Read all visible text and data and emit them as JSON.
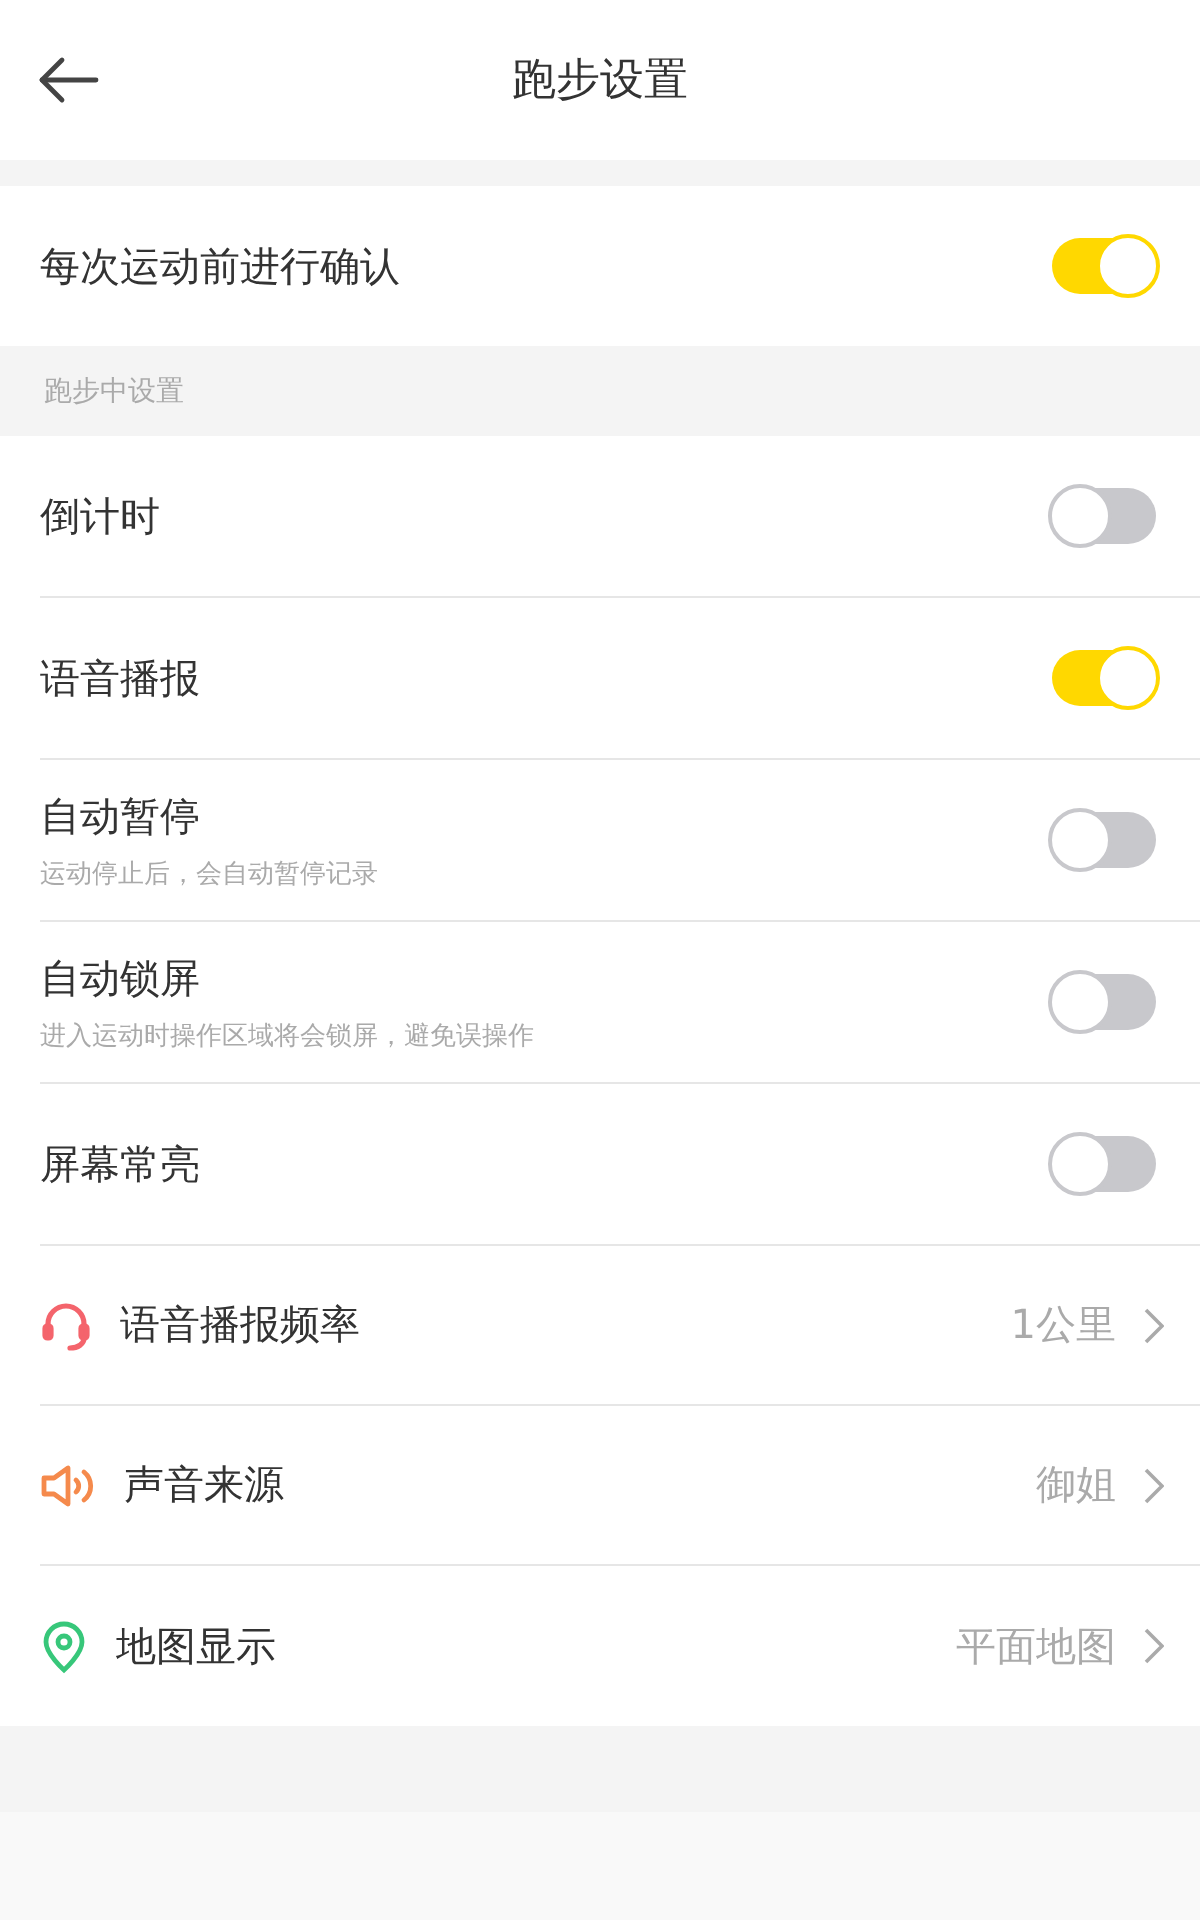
{
  "header": {
    "title": "跑步设置"
  },
  "top_rows": [
    {
      "label": "每次运动前进行确认",
      "on": true
    }
  ],
  "section_label": "跑步中设置",
  "toggle_rows": [
    {
      "label": "倒计时",
      "on": false
    },
    {
      "label": "语音播报",
      "on": true
    },
    {
      "label": "自动暂停",
      "hint": "运动停止后，会自动暂停记录",
      "on": false
    },
    {
      "label": "自动锁屏",
      "hint": "进入运动时操作区域将会锁屏，避免误操作",
      "on": false
    },
    {
      "label": "屏幕常亮",
      "on": false
    }
  ],
  "nav_rows": [
    {
      "label": "语音播报频率",
      "value": "1公里"
    },
    {
      "label": "声音来源",
      "value": "御姐"
    },
    {
      "label": "地图显示",
      "value": "平面地图"
    }
  ]
}
